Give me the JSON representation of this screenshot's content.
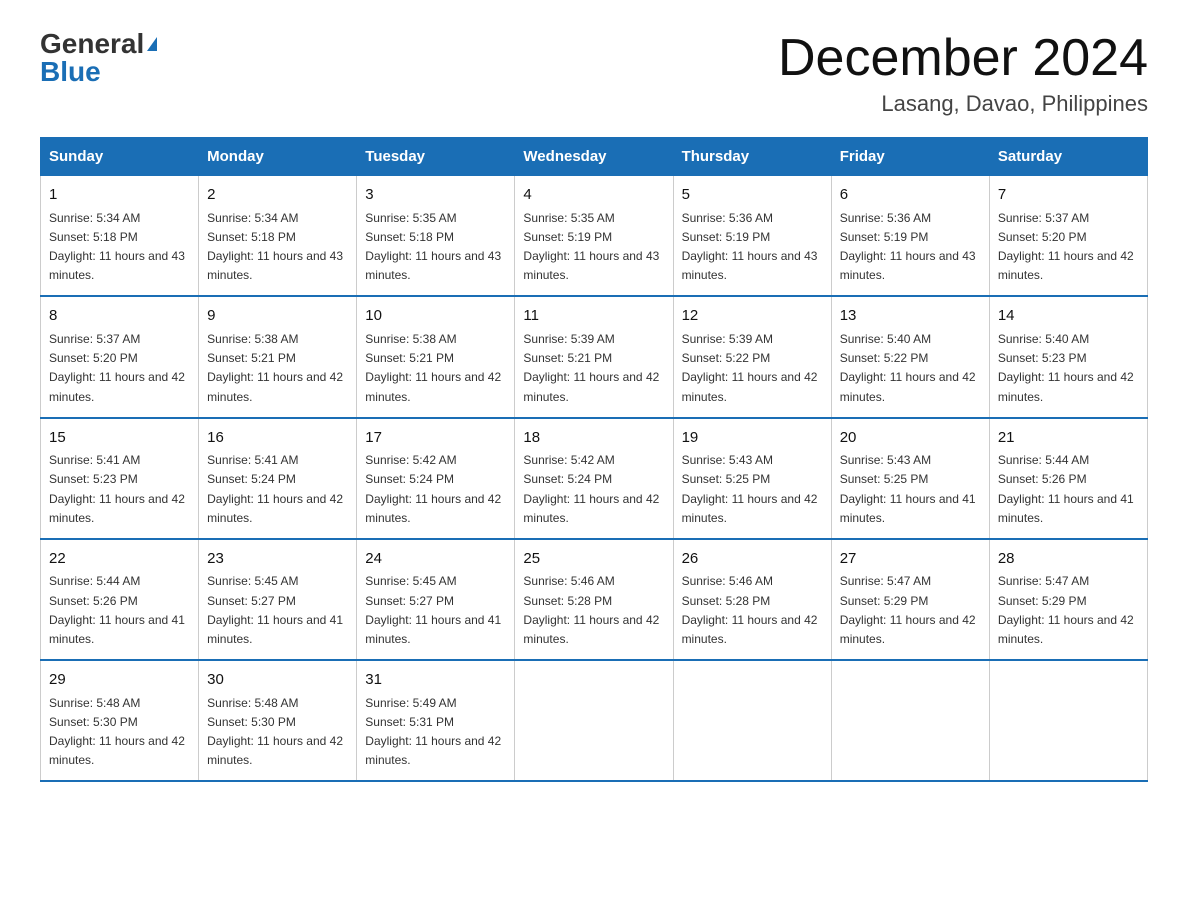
{
  "header": {
    "logo_general": "General",
    "logo_blue": "Blue",
    "title": "December 2024",
    "subtitle": "Lasang, Davao, Philippines"
  },
  "days_of_week": [
    "Sunday",
    "Monday",
    "Tuesday",
    "Wednesday",
    "Thursday",
    "Friday",
    "Saturday"
  ],
  "weeks": [
    [
      {
        "day": "1",
        "sunrise": "5:34 AM",
        "sunset": "5:18 PM",
        "daylight": "11 hours and 43 minutes."
      },
      {
        "day": "2",
        "sunrise": "5:34 AM",
        "sunset": "5:18 PM",
        "daylight": "11 hours and 43 minutes."
      },
      {
        "day": "3",
        "sunrise": "5:35 AM",
        "sunset": "5:18 PM",
        "daylight": "11 hours and 43 minutes."
      },
      {
        "day": "4",
        "sunrise": "5:35 AM",
        "sunset": "5:19 PM",
        "daylight": "11 hours and 43 minutes."
      },
      {
        "day": "5",
        "sunrise": "5:36 AM",
        "sunset": "5:19 PM",
        "daylight": "11 hours and 43 minutes."
      },
      {
        "day": "6",
        "sunrise": "5:36 AM",
        "sunset": "5:19 PM",
        "daylight": "11 hours and 43 minutes."
      },
      {
        "day": "7",
        "sunrise": "5:37 AM",
        "sunset": "5:20 PM",
        "daylight": "11 hours and 42 minutes."
      }
    ],
    [
      {
        "day": "8",
        "sunrise": "5:37 AM",
        "sunset": "5:20 PM",
        "daylight": "11 hours and 42 minutes."
      },
      {
        "day": "9",
        "sunrise": "5:38 AM",
        "sunset": "5:21 PM",
        "daylight": "11 hours and 42 minutes."
      },
      {
        "day": "10",
        "sunrise": "5:38 AM",
        "sunset": "5:21 PM",
        "daylight": "11 hours and 42 minutes."
      },
      {
        "day": "11",
        "sunrise": "5:39 AM",
        "sunset": "5:21 PM",
        "daylight": "11 hours and 42 minutes."
      },
      {
        "day": "12",
        "sunrise": "5:39 AM",
        "sunset": "5:22 PM",
        "daylight": "11 hours and 42 minutes."
      },
      {
        "day": "13",
        "sunrise": "5:40 AM",
        "sunset": "5:22 PM",
        "daylight": "11 hours and 42 minutes."
      },
      {
        "day": "14",
        "sunrise": "5:40 AM",
        "sunset": "5:23 PM",
        "daylight": "11 hours and 42 minutes."
      }
    ],
    [
      {
        "day": "15",
        "sunrise": "5:41 AM",
        "sunset": "5:23 PM",
        "daylight": "11 hours and 42 minutes."
      },
      {
        "day": "16",
        "sunrise": "5:41 AM",
        "sunset": "5:24 PM",
        "daylight": "11 hours and 42 minutes."
      },
      {
        "day": "17",
        "sunrise": "5:42 AM",
        "sunset": "5:24 PM",
        "daylight": "11 hours and 42 minutes."
      },
      {
        "day": "18",
        "sunrise": "5:42 AM",
        "sunset": "5:24 PM",
        "daylight": "11 hours and 42 minutes."
      },
      {
        "day": "19",
        "sunrise": "5:43 AM",
        "sunset": "5:25 PM",
        "daylight": "11 hours and 42 minutes."
      },
      {
        "day": "20",
        "sunrise": "5:43 AM",
        "sunset": "5:25 PM",
        "daylight": "11 hours and 41 minutes."
      },
      {
        "day": "21",
        "sunrise": "5:44 AM",
        "sunset": "5:26 PM",
        "daylight": "11 hours and 41 minutes."
      }
    ],
    [
      {
        "day": "22",
        "sunrise": "5:44 AM",
        "sunset": "5:26 PM",
        "daylight": "11 hours and 41 minutes."
      },
      {
        "day": "23",
        "sunrise": "5:45 AM",
        "sunset": "5:27 PM",
        "daylight": "11 hours and 41 minutes."
      },
      {
        "day": "24",
        "sunrise": "5:45 AM",
        "sunset": "5:27 PM",
        "daylight": "11 hours and 41 minutes."
      },
      {
        "day": "25",
        "sunrise": "5:46 AM",
        "sunset": "5:28 PM",
        "daylight": "11 hours and 42 minutes."
      },
      {
        "day": "26",
        "sunrise": "5:46 AM",
        "sunset": "5:28 PM",
        "daylight": "11 hours and 42 minutes."
      },
      {
        "day": "27",
        "sunrise": "5:47 AM",
        "sunset": "5:29 PM",
        "daylight": "11 hours and 42 minutes."
      },
      {
        "day": "28",
        "sunrise": "5:47 AM",
        "sunset": "5:29 PM",
        "daylight": "11 hours and 42 minutes."
      }
    ],
    [
      {
        "day": "29",
        "sunrise": "5:48 AM",
        "sunset": "5:30 PM",
        "daylight": "11 hours and 42 minutes."
      },
      {
        "day": "30",
        "sunrise": "5:48 AM",
        "sunset": "5:30 PM",
        "daylight": "11 hours and 42 minutes."
      },
      {
        "day": "31",
        "sunrise": "5:49 AM",
        "sunset": "5:31 PM",
        "daylight": "11 hours and 42 minutes."
      },
      null,
      null,
      null,
      null
    ]
  ]
}
